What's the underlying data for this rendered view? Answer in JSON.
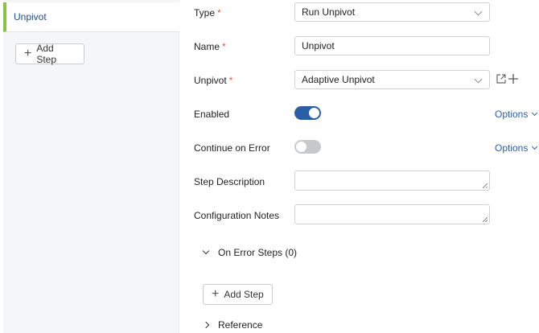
{
  "sidebar": {
    "steps": [
      {
        "label": "Unpivot"
      }
    ],
    "add_step_label": "Add Step"
  },
  "form": {
    "type": {
      "label": "Type",
      "value": "Run Unpivot"
    },
    "name": {
      "label": "Name",
      "value": "Unpivot"
    },
    "unpivot": {
      "label": "Unpivot",
      "value": "Adaptive Unpivot"
    },
    "enabled": {
      "label": "Enabled",
      "on": true,
      "options_label": "Options"
    },
    "continue_on_error": {
      "label": "Continue on Error",
      "on": false,
      "options_label": "Options"
    },
    "step_description": {
      "label": "Step Description",
      "value": ""
    },
    "configuration_notes": {
      "label": "Configuration Notes",
      "value": ""
    },
    "required_mark": "*"
  },
  "on_error_steps": {
    "label": "On Error Steps (0)",
    "add_step_label": "Add Step"
  },
  "reference": {
    "label": "Reference"
  },
  "colors": {
    "accent": "#2a5fa8",
    "active_step_bar": "#8bc34a",
    "required": "#e2574c"
  }
}
